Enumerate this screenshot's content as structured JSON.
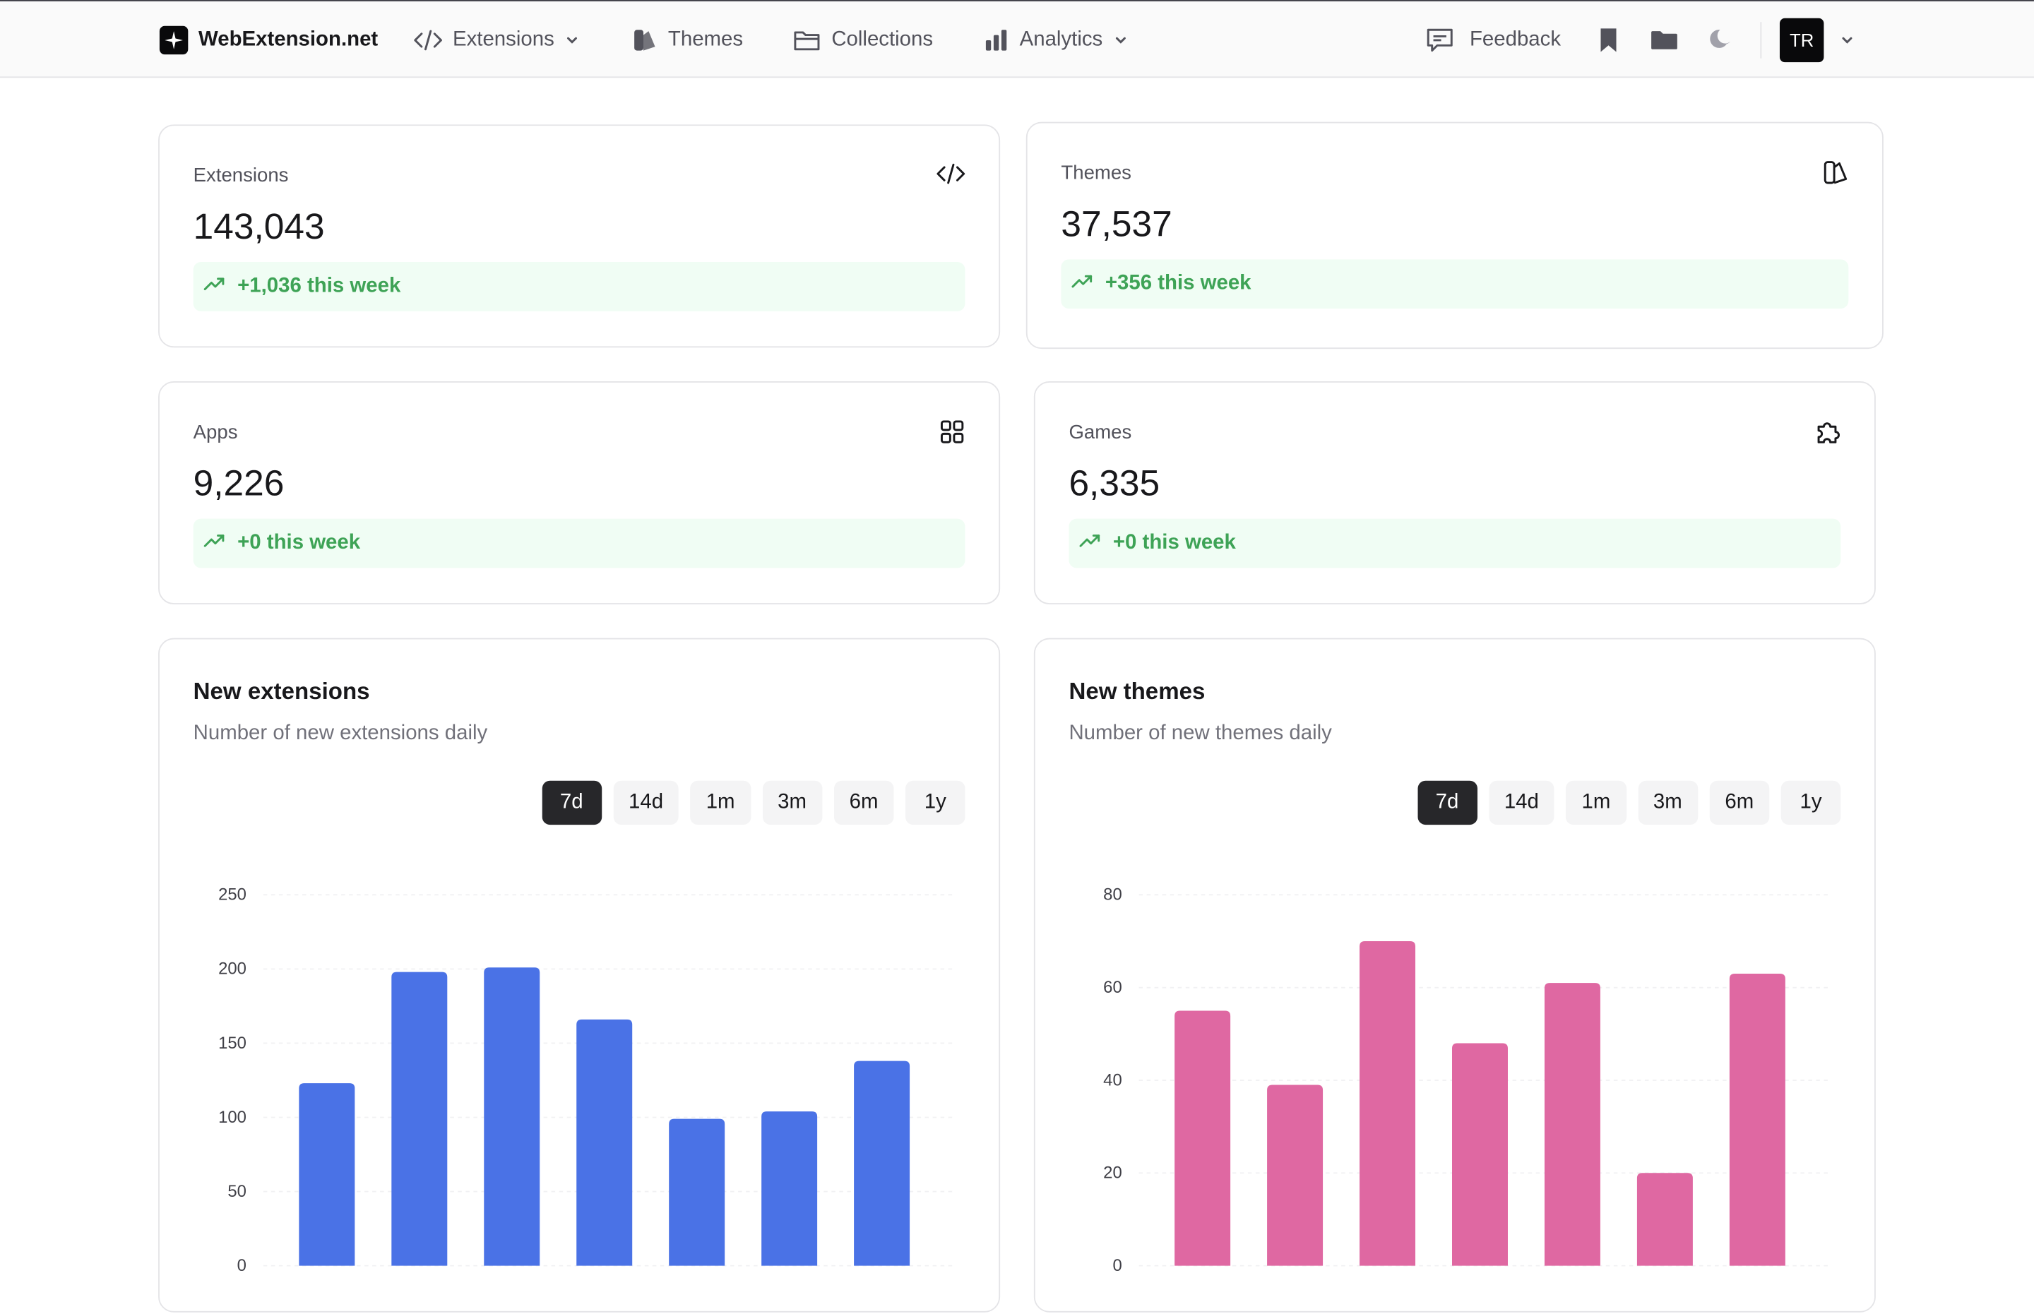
{
  "nav": {
    "brand": "WebExtension.net",
    "items": [
      {
        "label": "Extensions",
        "has_dropdown": true,
        "icon": "code-icon"
      },
      {
        "label": "Themes",
        "has_dropdown": false,
        "icon": "palette-icon"
      },
      {
        "label": "Collections",
        "has_dropdown": false,
        "icon": "folder-icon"
      },
      {
        "label": "Analytics",
        "has_dropdown": true,
        "icon": "bar-chart-icon"
      }
    ],
    "feedback": "Feedback",
    "avatar_initials": "TR"
  },
  "stats": [
    {
      "label": "Extensions",
      "value": "143,043",
      "trend": "+1,036 this week",
      "icon": "code-icon"
    },
    {
      "label": "Themes",
      "value": "37,537",
      "trend": "+356 this week",
      "icon": "palette-icon"
    },
    {
      "label": "Apps",
      "value": "9,226",
      "trend": "+0 this week",
      "icon": "grid-icon"
    },
    {
      "label": "Games",
      "value": "6,335",
      "trend": "+0 this week",
      "icon": "puzzle-icon"
    }
  ],
  "ranges": [
    "7d",
    "14d",
    "1m",
    "3m",
    "6m",
    "1y"
  ],
  "active_range": "7d",
  "colors": {
    "extensions_bar": "#4a72e6",
    "themes_bar": "#df68a2",
    "trend_green": "#3ea356"
  },
  "chart_data": [
    {
      "type": "bar",
      "title": "New extensions",
      "subtitle": "Number of new extensions daily",
      "yticks": [
        0,
        50,
        100,
        150,
        200,
        250
      ],
      "ylim": [
        0,
        250
      ],
      "values": [
        123,
        198,
        201,
        166,
        99,
        104,
        138
      ],
      "color": "#4a72e6",
      "grid": true
    },
    {
      "type": "bar",
      "title": "New themes",
      "subtitle": "Number of new themes daily",
      "yticks": [
        0,
        20,
        40,
        60,
        80
      ],
      "ylim": [
        0,
        80
      ],
      "values": [
        55,
        39,
        70,
        48,
        61,
        20,
        63
      ],
      "color": "#df68a2",
      "grid": true
    }
  ]
}
